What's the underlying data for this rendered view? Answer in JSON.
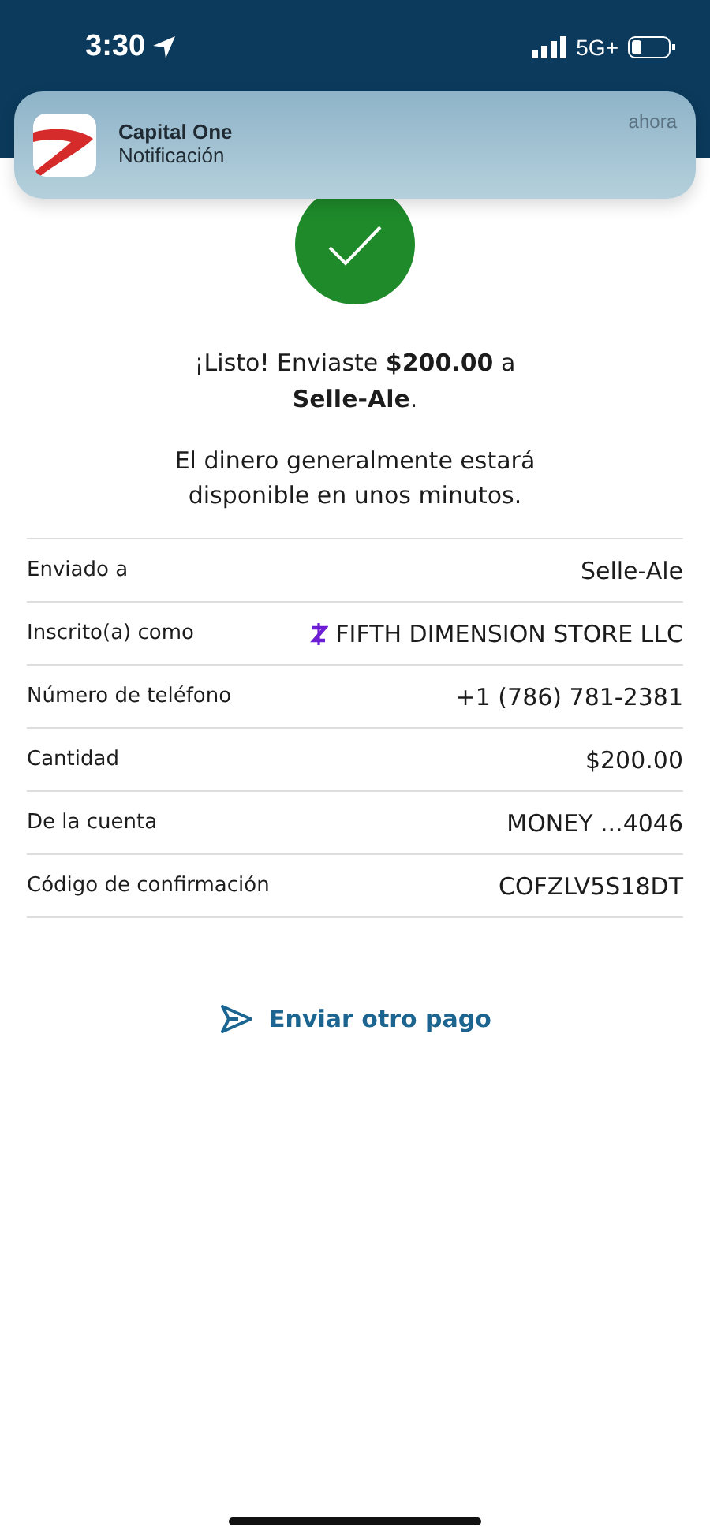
{
  "status_bar": {
    "time": "3:30",
    "network": "5G+"
  },
  "notification": {
    "app": "Capital One",
    "body": "Notificación",
    "time": "ahora"
  },
  "confirmation": {
    "title": "¡Listo! Enviaste **$200.00** a **Selle-Ale**.",
    "message": "El dinero generalmente estará disponible en unos minutos."
  },
  "details": [
    {
      "label": "Enviado a",
      "value": "Selle-Ale"
    },
    {
      "label": "Inscrito(a) como",
      "value": "FIFTH DIMENSION STORE LLC",
      "kind": "zelle"
    },
    {
      "label": "Número de teléfono",
      "value": "+1 (786) 781-2381"
    },
    {
      "label": "Cantidad",
      "value": "$200.00"
    },
    {
      "label": "De la cuenta",
      "value": "MONEY ...4046"
    },
    {
      "label": "Código de confirmación",
      "value": "COFZLV5S18DT"
    }
  ],
  "action": {
    "label": "Enviar otro pago"
  }
}
